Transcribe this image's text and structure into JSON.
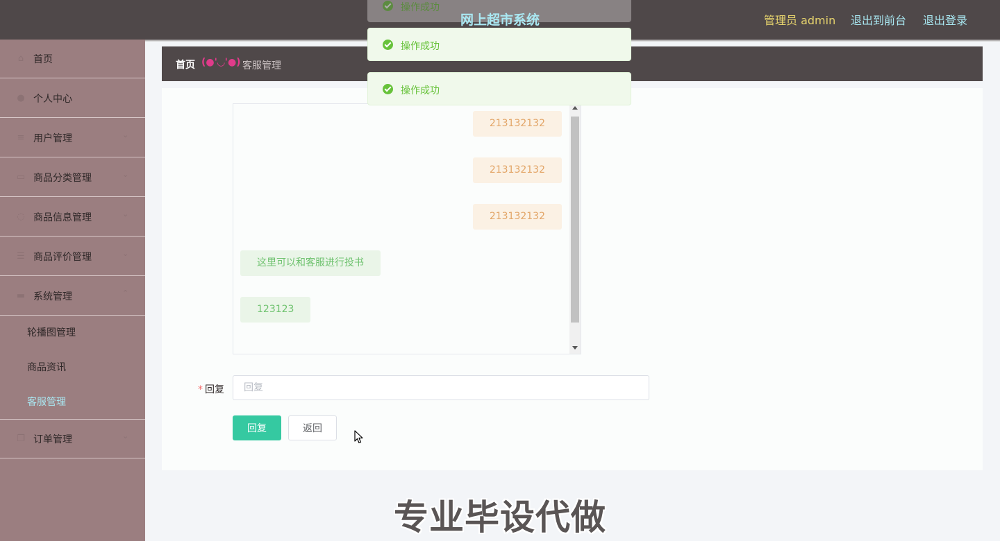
{
  "header": {
    "title": "网上超市系统",
    "user_label": "管理员 admin",
    "front_link": "退出到前台",
    "logout_link": "退出登录"
  },
  "sidebar": {
    "items": [
      {
        "label": "首页",
        "icon": "home-icon"
      },
      {
        "label": "个人中心",
        "icon": "user-icon"
      },
      {
        "label": "用户管理",
        "icon": "sliders-icon"
      },
      {
        "label": "商品分类管理",
        "icon": "chat-icon"
      },
      {
        "label": "商品信息管理",
        "icon": "power-icon"
      },
      {
        "label": "商品评价管理",
        "icon": "list-icon"
      },
      {
        "label": "系统管理",
        "icon": "briefcase-icon"
      },
      {
        "label": "订单管理",
        "icon": "copy-icon"
      }
    ],
    "submenu": [
      {
        "label": "轮播图管理"
      },
      {
        "label": "商品资讯"
      },
      {
        "label": "客服管理"
      }
    ]
  },
  "breadcrumb": {
    "home": "首页",
    "separator": "(●'◡'●)",
    "current": "客服管理"
  },
  "chat": {
    "messages": [
      {
        "side": "right",
        "text": "213132132"
      },
      {
        "side": "right",
        "text": "213132132"
      },
      {
        "side": "right",
        "text": "213132132"
      },
      {
        "side": "left",
        "text": "这里可以和客服进行投书"
      },
      {
        "side": "left",
        "text": "123123"
      }
    ]
  },
  "form": {
    "required_mark": "*",
    "reply_label": "回复",
    "reply_placeholder": "回复",
    "reply_value": "",
    "submit_button": "回复",
    "back_button": "返回"
  },
  "toasts": [
    {
      "text": "操作成功"
    },
    {
      "text": "操作成功"
    },
    {
      "text": "操作成功"
    }
  ],
  "watermark": "专业毕设代做",
  "colors": {
    "header_bg": "#4f4849",
    "sidebar_bg": "#9b7e80",
    "accent_cyan": "#a9e8f2",
    "accent_gold": "#e6d36d",
    "primary_button": "#35c9a1",
    "success": "#67c23a"
  }
}
